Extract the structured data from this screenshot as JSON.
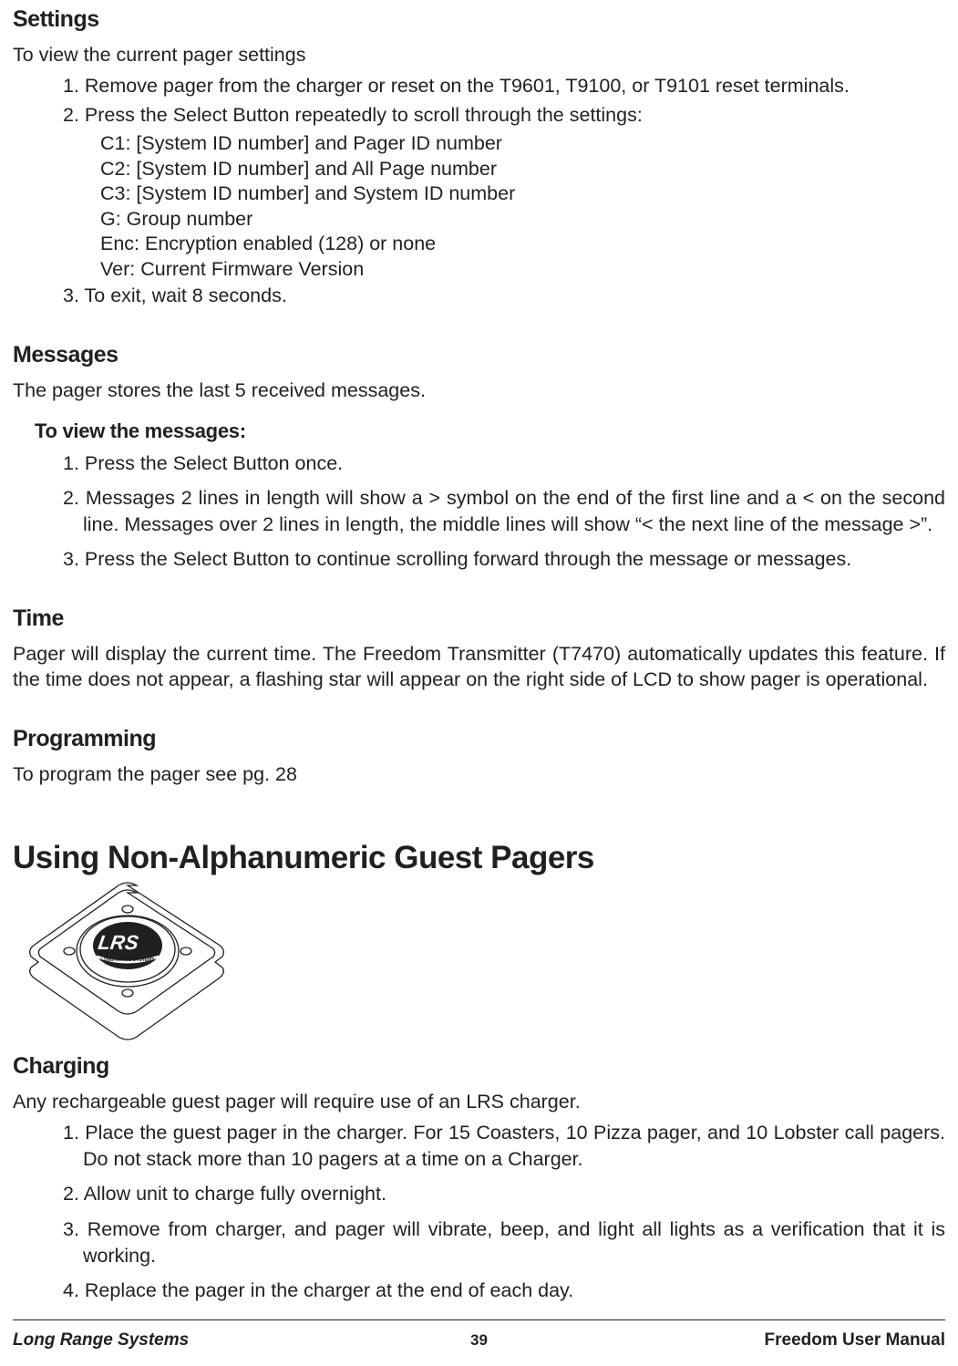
{
  "settings": {
    "heading": "Settings",
    "intro": "To view the current pager settings",
    "step1": "1. Remove pager from the charger or reset on the T9601, T9100, or T9101 reset terminals.",
    "step2": "2. Press the Select Button repeatedly to scroll through the settings:",
    "c1": "C1: [System ID number] and Pager ID number",
    "c2": "C2: [System ID number] and All Page number",
    "c3": "C3: [System ID number] and System ID number",
    "g": "G:  Group number",
    "enc": "Enc: Encryption enabled (128) or none",
    "ver": "Ver: Current Firmware Version",
    "step3": "3. To exit, wait 8 seconds."
  },
  "messages": {
    "heading": "Messages",
    "intro": "The pager stores the last 5 received messages.",
    "sub": "To view the messages:",
    "step1": "1. Press the Select Button once.",
    "step2": "2. Messages 2 lines in length will show a > symbol on the end of the first line and a < on the second line. Messages over 2 lines in length, the middle lines will show   “< the next line of the message >”.",
    "step3": "3. Press the Select Button to continue scrolling forward through the message or messages."
  },
  "time": {
    "heading": "Time",
    "body": "Pager will display the current time.  The Freedom Transmitter (T7470) automatically updates this feature.  If the time does not appear, a flashing star will appear on the right side of LCD to show pager is operational."
  },
  "programming": {
    "heading": "Programming",
    "body": "To program the pager see pg. 28"
  },
  "nonalpha": {
    "heading": "Using Non-Alphanumeric Guest Pagers"
  },
  "charging": {
    "heading": "Charging",
    "intro": "Any rechargeable guest pager will require use of an LRS charger.",
    "step1": "1. Place the guest pager in the charger.  For 15 Coasters, 10 Pizza pager, and 10 Lobster call pagers. Do not stack more than 10 pagers at a time on a Charger.",
    "step2": "2. Allow unit to charge fully overnight.",
    "step3": "3. Remove from charger, and pager will vibrate, beep, and light all lights as a verification that it is working.",
    "step4": "4. Replace the pager in the charger at the end of each day."
  },
  "footer": {
    "left": "Long Range Systems",
    "center": "39",
    "right": "Freedom User Manual"
  }
}
